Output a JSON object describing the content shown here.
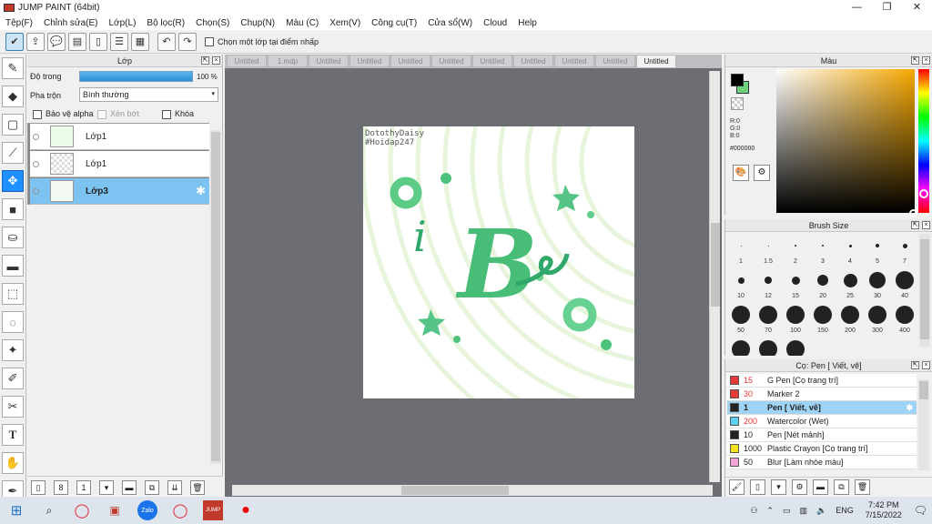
{
  "window": {
    "title": "JUMP PAINT (64bit)",
    "min": "—",
    "max": "❐",
    "close": "✕"
  },
  "menu": [
    "Tệp(F)",
    "Chỉnh sửa(E)",
    "Lớp(L)",
    "Bộ lọc(R)",
    "Chọn(S)",
    "Chụp(N)",
    "Màu (C)",
    "Xem(V)",
    "Công cụ(T)",
    "Cửa sổ(W)",
    "Cloud",
    "Help"
  ],
  "toolbar": {
    "pick_layer_label": "Chọn một lớp tại điểm nhấp",
    "undo_icon": "undo-arrow",
    "redo_icon": "redo-arrow"
  },
  "layer_panel": {
    "title": "Lớp",
    "opacity_label": "Độ trong",
    "opacity_value": "100 %",
    "opacity_fraction": 1.0,
    "blend_label": "Pha trộn",
    "blend_value": "Bình thường",
    "protect_alpha": "Bảo vệ alpha",
    "clip": "Xén bớt",
    "lock": "Khóa",
    "layers": [
      {
        "name": "Lớp1",
        "selected": false
      },
      {
        "name": "Lớp1",
        "selected": false
      },
      {
        "name": "Lớp3",
        "selected": true
      }
    ]
  },
  "tabs": [
    "Untitled",
    "1.mdp",
    "Untitled",
    "Untitled",
    "Untitled",
    "Untitled",
    "Untitled",
    "Untitled",
    "Untitled",
    "Untitled",
    "Untitled"
  ],
  "active_tab_index": 10,
  "artwork": {
    "watermark_line1": "DotothyDaisy",
    "watermark_line2": "#Hoidap247",
    "letter_left": "i",
    "letter_main": "B",
    "colors": {
      "green_dark": "#2fa86a",
      "green_light": "#7fd98f",
      "ring": "#e6f4da"
    }
  },
  "color_panel": {
    "title": "Màu",
    "r": "R:0",
    "g": "G:0",
    "b": "B:0",
    "hex": "#000000",
    "fg": "#000000",
    "bg": "#6fd17c"
  },
  "brush_size_panel": {
    "title": "Brush Size",
    "sizes": [
      "1",
      "1.5",
      "2",
      "3",
      "4",
      "5",
      "7",
      "10",
      "12",
      "15",
      "20",
      "25",
      "30",
      "40",
      "50",
      "70",
      "100",
      "150",
      "200",
      "300",
      "400"
    ]
  },
  "brush_panel": {
    "title": "Cọ: Pen [ Viết, vẽ]",
    "brushes": [
      {
        "size": "15",
        "name": "G Pen [Cọ trang trí]",
        "color": "#e53935",
        "selected": false
      },
      {
        "size": "30",
        "name": "Marker 2",
        "color": "#e53935",
        "selected": false
      },
      {
        "size": "1",
        "name": "Pen [ Viết, vẽ]",
        "color": "#222222",
        "selected": true
      },
      {
        "size": "200",
        "name": "Watercolor (Wet)",
        "color": "#5fd0ee",
        "selected": false
      },
      {
        "size": "10",
        "name": "Pen [Nét mảnh]",
        "color": "#222222",
        "selected": false
      },
      {
        "size": "1000",
        "name": "Plastic Crayon [Cọ trang trí]",
        "color": "#f3e21b",
        "selected": false
      },
      {
        "size": "50",
        "name": "Blur [Làm nhòe màu]",
        "color": "#f4a6d7",
        "selected": false
      }
    ]
  },
  "taskbar": {
    "time": "7:42 PM",
    "date": "7/15/2022",
    "lang": "ENG"
  }
}
